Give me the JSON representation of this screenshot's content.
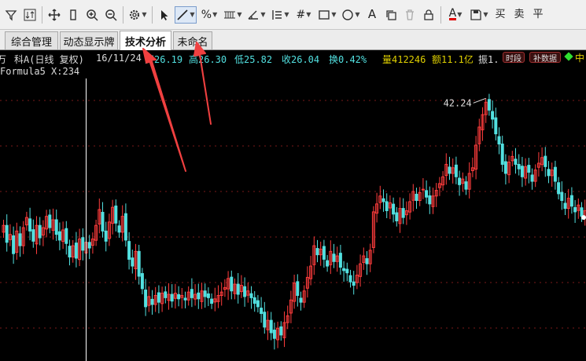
{
  "toolbar": {
    "icons": [
      "filter-icon",
      "sort-icon",
      "move-icon",
      "bar-width-icon",
      "zoom-in-icon",
      "zoom-out-icon",
      "settings-icon",
      "cursor-icon",
      "line-tool-icon",
      "percent-icon",
      "grid-ruler-icon",
      "angle-icon",
      "parallel-lines-icon",
      "hash-icon",
      "rectangle-icon",
      "circle-icon",
      "text-tool-icon",
      "copy-icon",
      "delete-icon",
      "lock-icon",
      "font-color-icon",
      "save-icon",
      "buy-icon",
      "sell-icon",
      "flatten-icon"
    ],
    "text_a": "A",
    "buy_label": "买",
    "sell_label": "卖",
    "flat_label": "平"
  },
  "tabs": [
    "综合管理",
    "动态显示牌",
    "技术分析",
    "未命名"
  ],
  "selected_tab": "技术分析",
  "info": {
    "lead": "万",
    "name": "科A(日线 复权)",
    "date": "16/11/24",
    "open": "开26.19",
    "high": "高26.30",
    "low": "低25.82",
    "close": "收26.04",
    "turnover": "换0.42%",
    "volume": "量412246",
    "amount": "额11.1亿",
    "amplitude": "振1.",
    "badge_time": "时段",
    "badge_fill": "补数据"
  },
  "formula": "Formula5 X:234",
  "chart_data": {
    "type": "candlestick",
    "max_label": "42.24",
    "ylim": [
      19,
      44
    ],
    "grid": "horizontal dashed",
    "colors": {
      "up": "#ff3c3c",
      "down": "#52e0e0",
      "cursor": "#ffffff"
    },
    "closes": [
      31,
      29.5,
      30.2,
      28.5,
      30.5,
      29.2,
      30.8,
      31.7,
      30.5,
      29.6,
      31.0,
      29.9,
      30.8,
      31.8,
      30.8,
      31.5,
      30.2,
      29.7,
      30.6,
      29.4,
      28.2,
      29.2,
      28.1,
      29.8,
      28.8,
      29.5,
      29.0,
      29.8,
      31.0,
      32.4,
      30.5,
      29.6,
      31.3,
      32.6,
      31.2,
      30.4,
      31.8,
      29.7,
      28.0,
      27.4,
      28.7,
      26.5,
      25.4,
      23.8,
      24.7,
      24.0,
      24.8,
      24.2,
      25.0,
      24.6,
      24.9,
      24.3,
      25.0,
      24.5,
      24.8,
      24.4,
      25.1,
      24.6,
      24.9,
      24.5,
      25.2,
      24.7,
      24.6,
      24.1,
      24.5,
      24.8,
      25.1,
      25.5,
      26.3,
      25.2,
      25.8,
      24.9,
      25.7,
      24.7,
      25.2,
      24.6,
      24.1,
      23.8,
      23.2,
      22.0,
      22.6,
      21.5,
      21.0,
      21.9,
      21.3,
      22.4,
      23.0,
      24.4,
      25.9,
      24.8,
      24.2,
      25.2,
      26.4,
      27.4,
      29.2,
      28.4,
      28.9,
      28.0,
      27.4,
      28.7,
      27.8,
      28.3,
      27.3,
      27.0,
      26.8,
      26.0,
      25.7,
      26.6,
      27.6,
      28.3,
      27.6,
      28.8,
      32.2,
      32.9,
      33.6,
      33.1,
      32.3,
      33.0,
      32.0,
      31.4,
      32.5,
      31.7,
      32.3,
      33.1,
      34.0,
      33.2,
      33.9,
      34.2,
      33.5,
      32.9,
      33.6,
      34.1,
      34.7,
      35.3,
      36.4,
      35.6,
      36.1,
      35.3,
      34.6,
      35.1,
      34.2,
      35.6,
      36.1,
      38.1,
      39.7,
      40.8,
      41.9,
      41.2,
      40.4,
      39.1,
      38.2,
      36.4,
      35.6,
      36.6,
      37.1,
      36.4,
      36.0,
      35.3,
      36.2,
      35.7,
      34.9,
      35.9,
      36.5,
      37.0,
      36.2,
      35.4,
      35.9,
      34.9,
      33.8,
      33.2,
      32.5,
      33.4,
      32.7,
      32.2,
      32.8,
      31.8,
      32.3,
      31.7
    ],
    "cursor_index": 25,
    "partial_right_tag": "中"
  }
}
